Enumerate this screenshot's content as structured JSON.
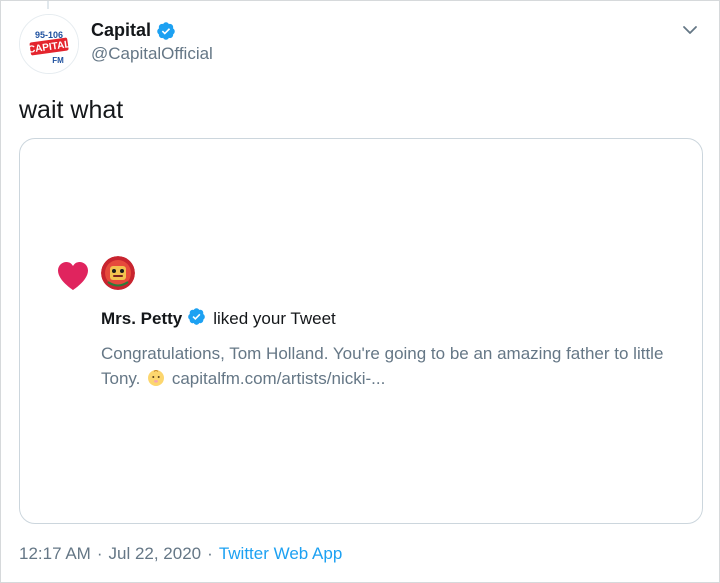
{
  "account": {
    "display_name": "Capital",
    "handle": "@CapitalOfficial",
    "avatar_logo": {
      "frequency": "95-106",
      "brand": "CAPITAL",
      "suffix": "FM"
    },
    "verified": true
  },
  "tweet": {
    "text": "wait what"
  },
  "embedded_notification": {
    "liker_name": "Mrs. Petty",
    "action_text": "liked your Tweet",
    "quoted_text_main": "Congratulations, Tom Holland. You're going to be an amazing father to little Tony.",
    "quoted_link": "capitalfm.com/artists/nicki-...",
    "icons": [
      "heart-icon",
      "verified-badge-icon",
      "baby-emoji"
    ]
  },
  "footer": {
    "time": "12:17 AM",
    "separator_1": "·",
    "date": "Jul 22, 2020",
    "separator_2": "·",
    "source": "Twitter Web App"
  },
  "colors": {
    "accent": "#1da1f2",
    "heart": "#e0245e",
    "secondary_text": "#657786",
    "brand_blue": "#1d4f9e",
    "brand_red": "#e4242d"
  }
}
